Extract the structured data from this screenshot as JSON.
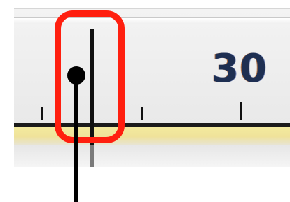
{
  "ruler": {
    "number_label": "30"
  },
  "colors": {
    "highlight_ring": "#ff1f0f",
    "ruler_background": "#ececec",
    "number_text": "#1e2f52",
    "baseline_yellow": "#f2e89c",
    "tick": "#111111"
  },
  "icons": {
    "pointer": "callout-pointer-icon",
    "highlight": "highlight-ring-icon"
  }
}
